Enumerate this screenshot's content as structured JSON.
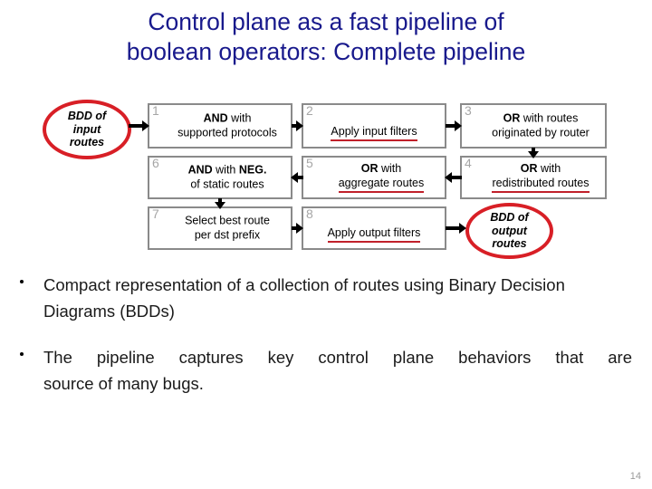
{
  "slide": {
    "title_line1": "Control plane as a fast pipeline of",
    "title_line2": "boolean operators: Complete pipeline",
    "title_color": "#18198c",
    "page_number": "14"
  },
  "diagram": {
    "input_node": {
      "line1": "BDD of",
      "line2": "input",
      "line3": "routes"
    },
    "output_node": {
      "line1": "BDD of",
      "line2": "output",
      "line3": "routes"
    },
    "accent_red": "#d81f26",
    "underline_red": "#c0202a",
    "box_border": "#8a8a8a",
    "number_color": "#a6a6a6",
    "stages": [
      {
        "num": "1",
        "line1_bold": "AND",
        "line1_rest": " with",
        "line2": "supported protocols",
        "underline": ""
      },
      {
        "num": "2",
        "line1_bold": "",
        "line1_rest": "",
        "line2": "Apply input filters",
        "underline": "input filters"
      },
      {
        "num": "3",
        "line1_bold": "OR",
        "line1_rest": " with routes",
        "line2": "originated by router",
        "underline": ""
      },
      {
        "num": "4",
        "line1_bold": "OR",
        "line1_rest": " with",
        "line2": "redistributed routes",
        "underline": "redistributed routes"
      },
      {
        "num": "5",
        "line1_bold": "OR",
        "line1_rest": " with",
        "line2": "aggregate routes",
        "underline": "aggregate routes"
      },
      {
        "num": "6",
        "line1_bold": "AND",
        "line1_rest": " with ",
        "line1_bold2": "NEG.",
        "line2": "of static routes",
        "underline": ""
      },
      {
        "num": "7",
        "line1_bold": "",
        "line1_rest": "",
        "line2": "Select best route",
        "line3": "per dst prefix",
        "underline": ""
      },
      {
        "num": "8",
        "line1_bold": "",
        "line1_rest": "",
        "line2": "Apply output filters",
        "underline": "output filters"
      }
    ]
  },
  "bullets": [
    {
      "text": "Compact representation of a collection of routes using Binary Decision Diagrams (BDDs)",
      "head": "Compact representation of a collection of routes using Binary",
      "tail": "Decision Diagrams (BDDs)"
    },
    {
      "text": "The pipeline captures key control plane behaviors that are source of many bugs.",
      "head": "The pipeline captures key control plane behaviors that are",
      "tail": "source of many bugs."
    }
  ]
}
